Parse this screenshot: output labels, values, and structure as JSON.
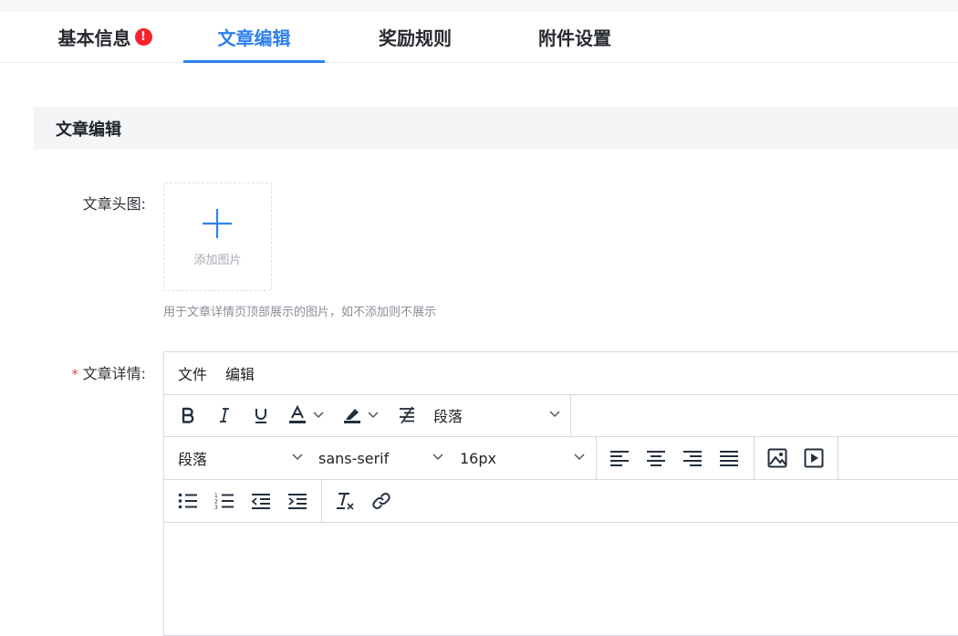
{
  "tabs": [
    {
      "label": "基本信息",
      "badge": "!"
    },
    {
      "label": "文章编辑"
    },
    {
      "label": "奖励规则"
    },
    {
      "label": "附件设置"
    }
  ],
  "section": {
    "title": "文章编辑"
  },
  "form": {
    "cover_label": "文章头图:",
    "upload_text": "添加图片",
    "cover_hint": "用于文章详情页顶部展示的图片，如不添加则不展示",
    "required_mark": "*",
    "detail_label": "文章详情:"
  },
  "editor": {
    "menu": [
      "文件",
      "编辑"
    ],
    "block_select": "段落",
    "format_select": "段落",
    "font_select": "sans-serif",
    "size_select": "16px",
    "icons": {
      "bold": "bold-icon",
      "italic": "italic-icon",
      "underline": "underline-icon",
      "text_color": "text-color-icon",
      "highlight": "highlight-icon",
      "strikethrough": "strikethrough-icon",
      "align_left": "align-left-icon",
      "align_center": "align-center-icon",
      "align_right": "align-right-icon",
      "justify": "justify-icon",
      "image": "image-icon",
      "video": "video-icon",
      "bullet_list": "bullet-list-icon",
      "numbered_list": "numbered-list-icon",
      "outdent": "outdent-icon",
      "indent": "indent-icon",
      "clear_format": "clear-format-icon",
      "link": "link-icon"
    }
  },
  "colors": {
    "accent": "#2f80ed",
    "danger": "#f5222d",
    "border": "#d5d8dc"
  }
}
